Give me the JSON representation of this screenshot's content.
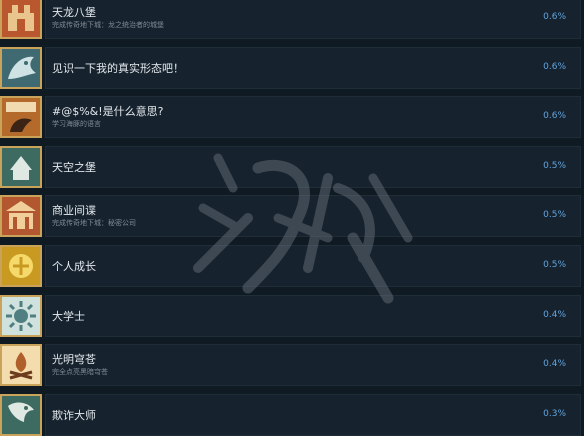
{
  "achievements": [
    {
      "title": "天龙八堡",
      "desc": "完成传奇地下城：龙之统治者的城堡",
      "percent": "0.6%",
      "icon": "fortress-icon",
      "color": "#b9582f"
    },
    {
      "title": "见识一下我的真实形态吧！",
      "desc": "",
      "percent": "0.6%",
      "icon": "dragon-icon",
      "color": "#3f6a72"
    },
    {
      "title": "#@$%&!是什么意思?",
      "desc": "学习海豚的语言",
      "percent": "0.6%",
      "icon": "dolphin-sign-icon",
      "color": "#b46a2a"
    },
    {
      "title": "天空之堡",
      "desc": "",
      "percent": "0.5%",
      "icon": "sky-castle-icon",
      "color": "#3d6b62"
    },
    {
      "title": "商业间谍",
      "desc": "完成传奇地下城：秘密公司",
      "percent": "0.5%",
      "icon": "office-icon",
      "color": "#b25730"
    },
    {
      "title": "个人成长",
      "desc": "",
      "percent": "0.5%",
      "icon": "growth-icon",
      "color": "#c99a22"
    },
    {
      "title": "大学士",
      "desc": "",
      "percent": "0.4%",
      "icon": "scholar-sun-icon",
      "color": "#4f7f80"
    },
    {
      "title": "光明穹苍",
      "desc": "完全点亮黑暗穹苍",
      "percent": "0.4%",
      "icon": "bonfire-icon",
      "color": "#b0602a"
    },
    {
      "title": "欺诈大师",
      "desc": "",
      "percent": "0.3%",
      "icon": "trickster-icon",
      "color": "#3d6b62"
    }
  ],
  "watermark": {
    "text": "游侠网"
  }
}
